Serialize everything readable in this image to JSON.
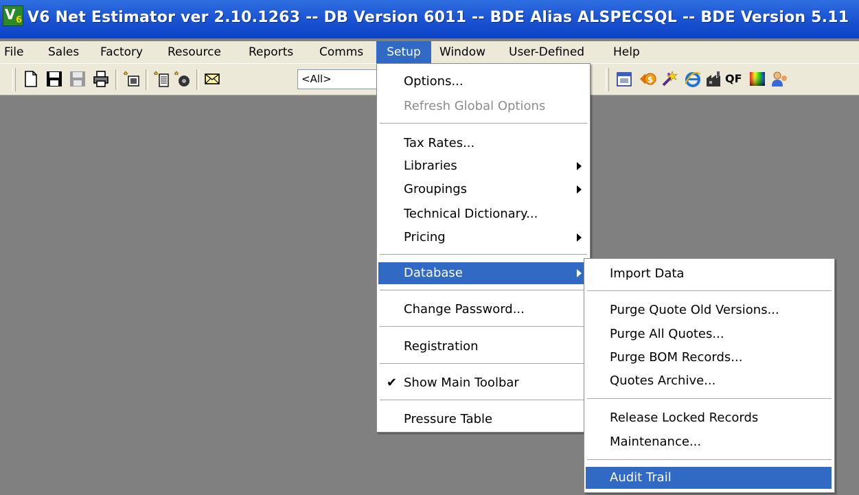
{
  "window": {
    "title": "V6 Net Estimator ver 2.10.1263 -- DB Version 6011 -- BDE Alias ALSPECSQL -- BDE Version 5.11",
    "icon_text": "V",
    "icon_subtext": "6"
  },
  "menubar": {
    "items": [
      "File",
      "Sales",
      "Factory",
      "Resource",
      "Reports",
      "Comms",
      "Setup",
      "Window",
      "User-Defined",
      "Help"
    ]
  },
  "toolbar": {
    "filter_value": "<All>",
    "qf_label": "QF"
  },
  "setup_menu": {
    "options": "Options...",
    "refresh_global_options": "Refresh Global Options",
    "tax_rates": "Tax Rates...",
    "libraries": "Libraries",
    "groupings": "Groupings",
    "technical_dictionary": "Technical Dictionary...",
    "pricing": "Pricing",
    "database": "Database",
    "change_password": "Change Password...",
    "registration": "Registration",
    "show_main_toolbar": "Show Main Toolbar",
    "pressure_table": "Pressure Table"
  },
  "database_submenu": {
    "import_data": "Import Data",
    "purge_quote_old_versions": "Purge Quote Old Versions...",
    "purge_all_quotes": "Purge All Quotes...",
    "purge_bom_records": "Purge BOM Records...",
    "quotes_archive": "Quotes Archive...",
    "release_locked_records": "Release Locked Records",
    "maintenance": "Maintenance...",
    "audit_trail": "Audit Trail"
  },
  "colors": {
    "titlebar": "#0a42c4",
    "menu_highlight": "#316ac5",
    "workspace": "#808080",
    "chrome": "#ece9d8"
  }
}
